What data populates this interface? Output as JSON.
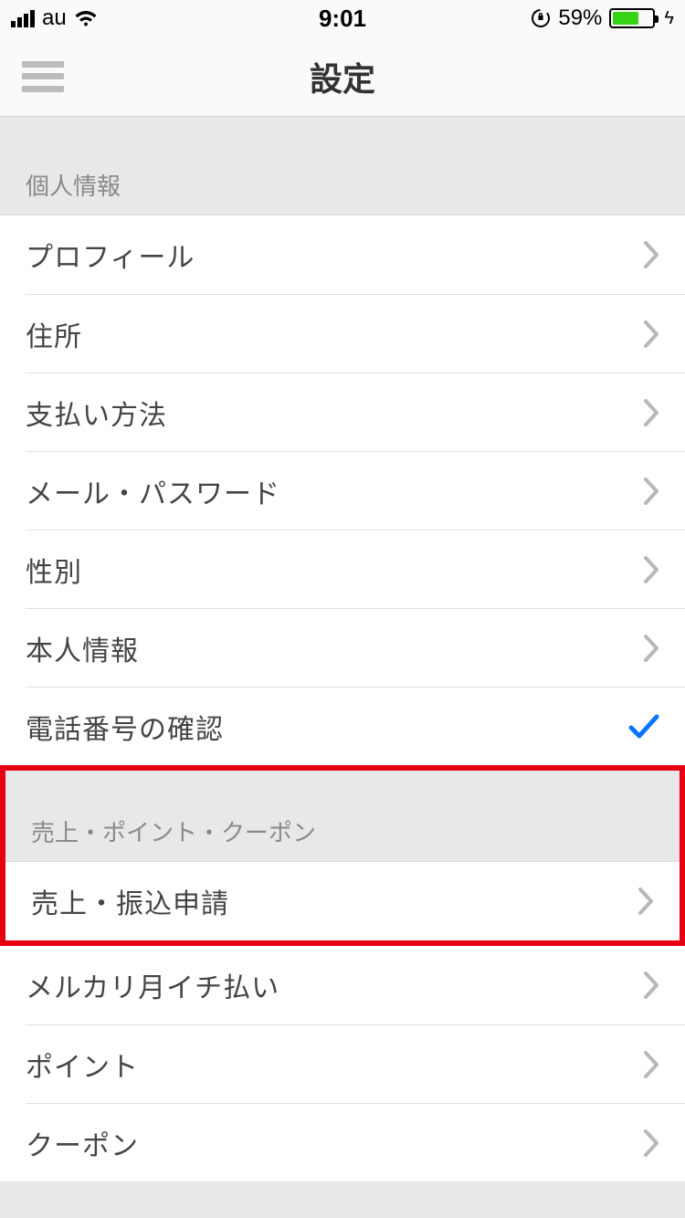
{
  "status": {
    "carrier": "au",
    "time": "9:01",
    "battery_pct": "59%",
    "battery_fill_pct": 59
  },
  "nav": {
    "title": "設定"
  },
  "sections": [
    {
      "header": "個人情報",
      "items": [
        {
          "label": "プロフィール",
          "accessory": "chevron"
        },
        {
          "label": "住所",
          "accessory": "chevron"
        },
        {
          "label": "支払い方法",
          "accessory": "chevron"
        },
        {
          "label": "メール・パスワード",
          "accessory": "chevron"
        },
        {
          "label": "性別",
          "accessory": "chevron"
        },
        {
          "label": "本人情報",
          "accessory": "chevron"
        },
        {
          "label": "電話番号の確認",
          "accessory": "check"
        }
      ]
    },
    {
      "header": "売上・ポイント・クーポン",
      "items": [
        {
          "label": "売上・振込申請",
          "accessory": "chevron",
          "highlighted": true
        },
        {
          "label": "メルカリ月イチ払い",
          "accessory": "chevron"
        },
        {
          "label": "ポイント",
          "accessory": "chevron"
        },
        {
          "label": "クーポン",
          "accessory": "chevron"
        }
      ]
    }
  ],
  "colors": {
    "highlight_border": "#e60012",
    "check_blue": "#0b74ff",
    "battery_green": "#37d315"
  }
}
